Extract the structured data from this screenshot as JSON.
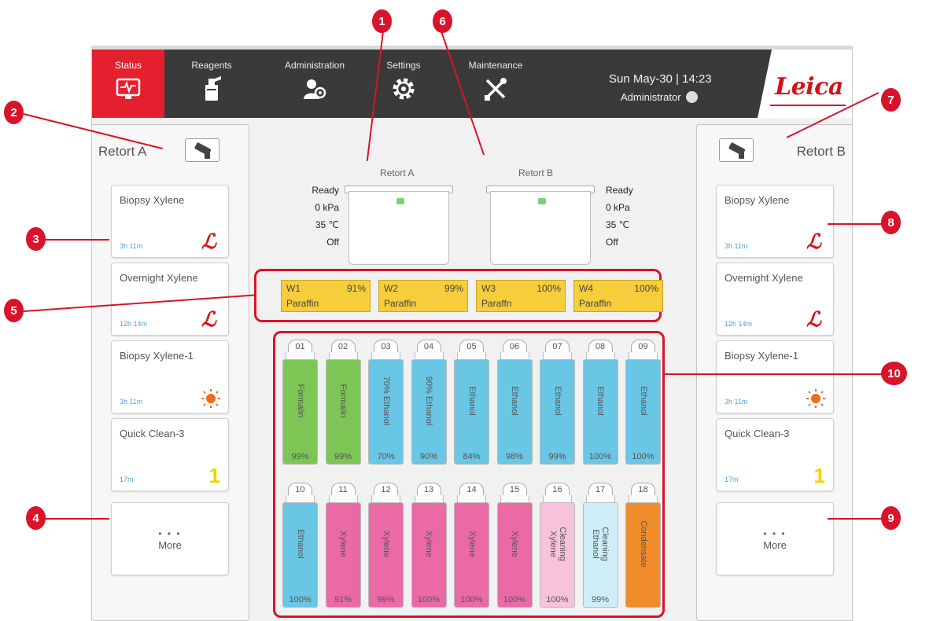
{
  "nav": {
    "tabs": [
      {
        "label": "Status",
        "icon": "status-monitor-icon"
      },
      {
        "label": "Reagents",
        "icon": "reagent-bottle-icon"
      },
      {
        "label": "Administration",
        "icon": "users-gear-icon"
      },
      {
        "label": "Settings",
        "icon": "gear-icon"
      },
      {
        "label": "Maintenance",
        "icon": "wrench-screwdriver-icon"
      }
    ],
    "active": "Status",
    "datetime": "Sun May-30 | 14:23",
    "user": "Administrator",
    "brand": "Leica"
  },
  "retort_a": {
    "panel_title": "Retort A",
    "protocols": [
      {
        "name": "Biopsy Xylene",
        "duration": "3h 11m",
        "icon": "leica-l-icon"
      },
      {
        "name": "Overnight Xylene",
        "duration": "12h 14m",
        "icon": "leica-l-icon"
      },
      {
        "name": "Biopsy Xylene-1",
        "duration": "3h 11m",
        "icon": "sun-icon"
      },
      {
        "name": "Quick Clean-3",
        "duration": "17m",
        "icon": "number-one-icon"
      }
    ],
    "more_label": "More",
    "status": {
      "name": "Retort A",
      "state": "Ready",
      "pressure": "0 kPa",
      "temperature": "35 ℃",
      "agitator": "Off"
    }
  },
  "retort_b": {
    "panel_title": "Retort B",
    "protocols": [
      {
        "name": "Biopsy Xylene",
        "duration": "3h 11m",
        "icon": "leica-l-icon"
      },
      {
        "name": "Overnight Xylene",
        "duration": "12h 14m",
        "icon": "leica-l-icon"
      },
      {
        "name": "Biopsy Xylene-1",
        "duration": "3h 11m",
        "icon": "sun-icon"
      },
      {
        "name": "Quick Clean-3",
        "duration": "17m",
        "icon": "number-one-icon"
      }
    ],
    "more_label": "More",
    "status": {
      "name": "Retort B",
      "state": "Ready",
      "pressure": "0 kPa",
      "temperature": "35 ℃",
      "agitator": "Off"
    }
  },
  "paraffin_baths": [
    {
      "id": "W1",
      "pct": "91%",
      "name": "Paraffin"
    },
    {
      "id": "W2",
      "pct": "99%",
      "name": "Paraffin"
    },
    {
      "id": "W3",
      "pct": "100%",
      "name": "Paraffn"
    },
    {
      "id": "W4",
      "pct": "100%",
      "name": "Paraffin"
    }
  ],
  "bottles": [
    {
      "num": "01",
      "name": "Formalin",
      "pct": "99%",
      "color": "#7dc656",
      "level": 1.0
    },
    {
      "num": "02",
      "name": "Formalin",
      "pct": "99%",
      "color": "#7dc656",
      "level": 1.0
    },
    {
      "num": "03",
      "name": "70% Ethanol",
      "pct": "70%",
      "color": "#69c6e4",
      "level": 1.0
    },
    {
      "num": "04",
      "name": "90% Ethanol",
      "pct": "90%",
      "color": "#69c6e4",
      "level": 1.0
    },
    {
      "num": "05",
      "name": "Ethanol",
      "pct": "84%",
      "color": "#69c6e4",
      "level": 1.0
    },
    {
      "num": "06",
      "name": "Ethanol",
      "pct": "98%",
      "color": "#69c6e4",
      "level": 1.0
    },
    {
      "num": "07",
      "name": "Ethanol",
      "pct": "99%",
      "color": "#69c6e4",
      "level": 1.0
    },
    {
      "num": "08",
      "name": "Ethanol",
      "pct": "100%",
      "color": "#69c6e4",
      "level": 1.0
    },
    {
      "num": "09",
      "name": "Ethanol",
      "pct": "100%",
      "color": "#69c6e4",
      "level": 1.0
    },
    {
      "num": "10",
      "name": "Ethanol",
      "pct": "100%",
      "color": "#69c6e4",
      "level": 1.0
    },
    {
      "num": "11",
      "name": "Xylene",
      "pct": "91%",
      "color": "#eb6aa6",
      "level": 1.0
    },
    {
      "num": "12",
      "name": "Xylene",
      "pct": "99%",
      "color": "#eb6aa6",
      "level": 1.0
    },
    {
      "num": "13",
      "name": "Xylene",
      "pct": "100%",
      "color": "#eb6aa6",
      "level": 1.0
    },
    {
      "num": "14",
      "name": "Xylene",
      "pct": "100%",
      "color": "#eb6aa6",
      "level": 1.0
    },
    {
      "num": "15",
      "name": "Xylene",
      "pct": "100%",
      "color": "#eb6aa6",
      "level": 1.0
    },
    {
      "num": "16",
      "name": "Cleaning\nXylene",
      "pct": "100%",
      "color": "#f7c3da",
      "level": 1.0
    },
    {
      "num": "17",
      "name": "Cleaning\nEthanol",
      "pct": "99%",
      "color": "#cdeef8",
      "level": 1.0
    },
    {
      "num": "18",
      "name": "Condensate",
      "pct": "",
      "color": "#f08c2a",
      "level": 1.0
    }
  ],
  "callouts": [
    "1",
    "2",
    "3",
    "4",
    "5",
    "6",
    "7",
    "8",
    "9",
    "10"
  ],
  "colors": {
    "accent": "#e5202e",
    "callout": "#d9132a",
    "topbar": "#3a3a3a",
    "paraffin": "#f6cd3a"
  }
}
